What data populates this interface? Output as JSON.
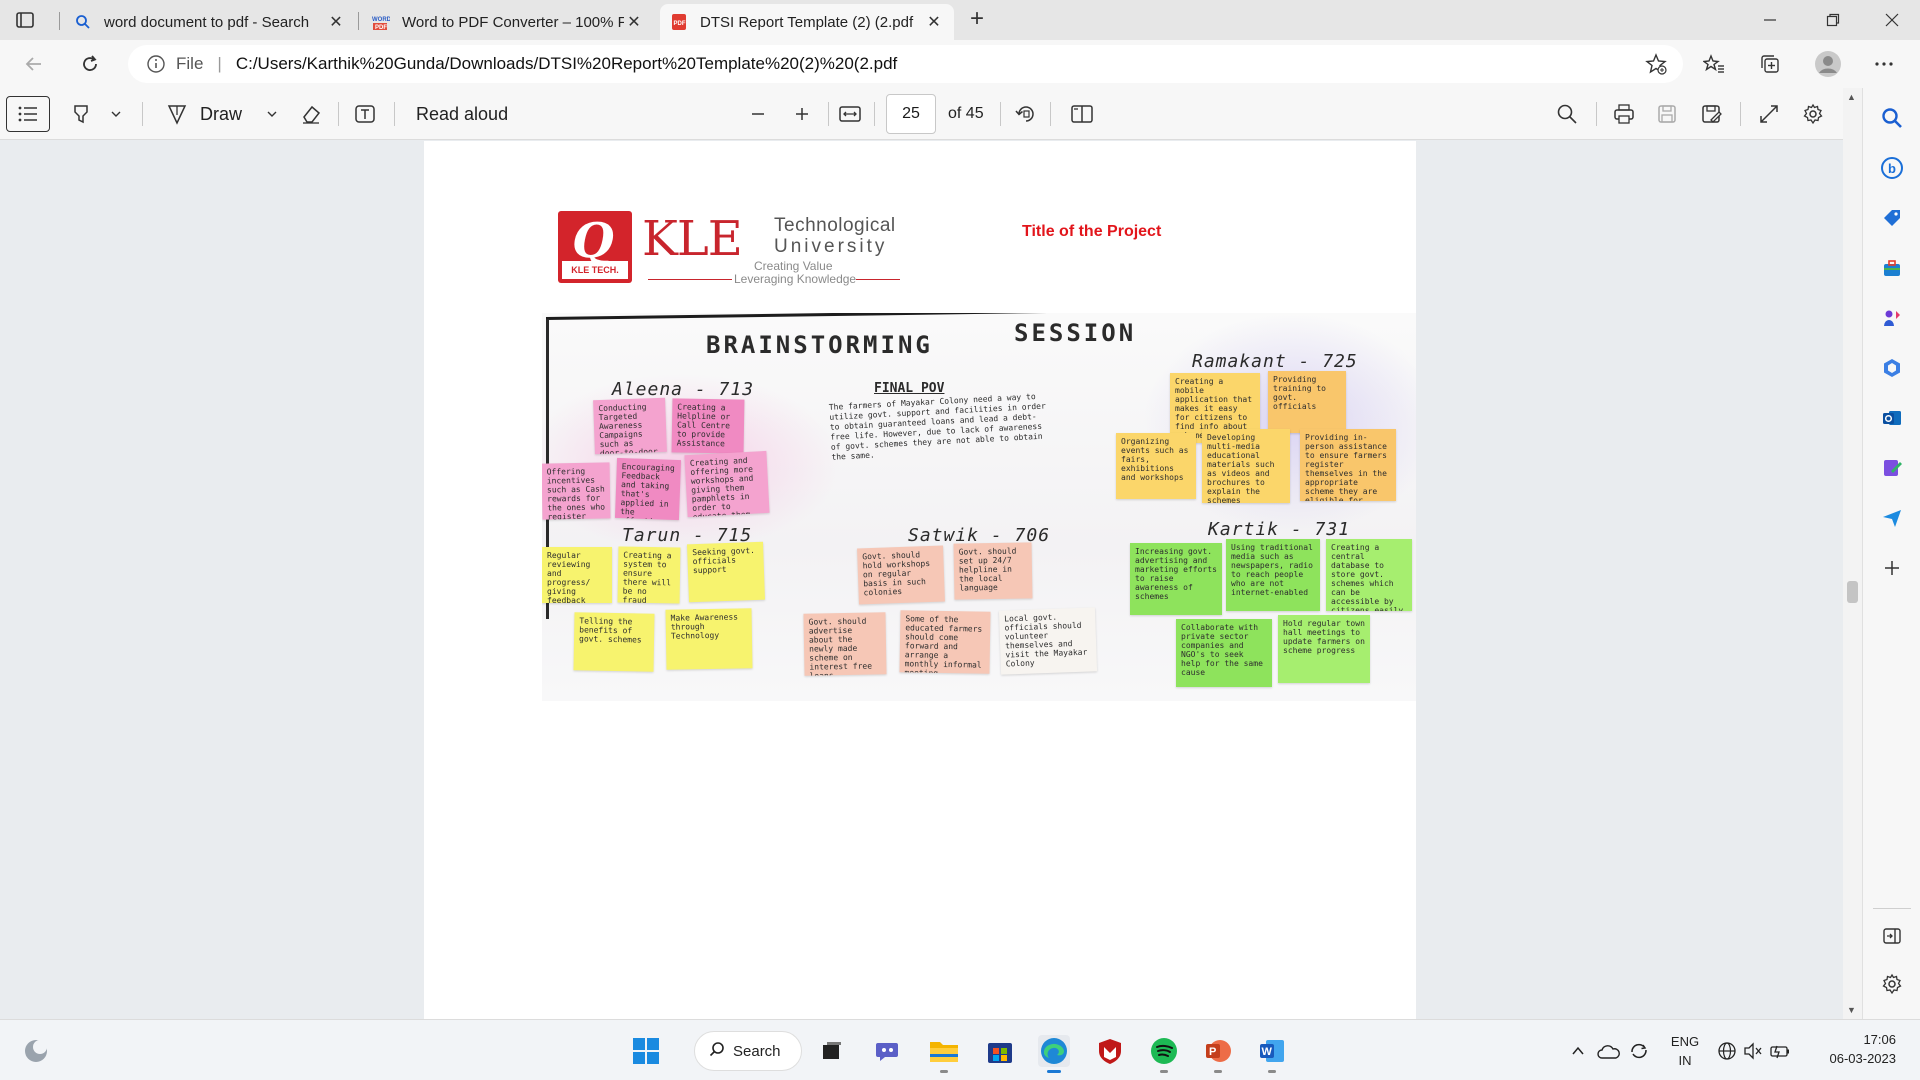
{
  "browser": {
    "tabs": [
      {
        "title": "word document to pdf - Search",
        "favicon": "search-icon",
        "active": false
      },
      {
        "title": "Word to PDF Converter – 100% F",
        "favicon": "word-pdf-icon",
        "active": false
      },
      {
        "title": "DTSI Report Template (2) (2.pdf",
        "favicon": "pdf-icon",
        "active": true
      }
    ],
    "address": {
      "scheme_label": "File",
      "url": "C:/Users/Karthik%20Gunda/Downloads/DTSI%20Report%20Template%20(2)%20(2.pdf"
    }
  },
  "pdf_toolbar": {
    "draw_label": "Draw",
    "read_aloud_label": "Read aloud",
    "current_page": "25",
    "page_count_label": "of 45"
  },
  "document": {
    "logo": {
      "kle": "KLE",
      "technological": "Technological",
      "university": "University",
      "tagline1": "Creating Value",
      "tagline2": "Leveraging Knowledge",
      "badge": "KLE TECH."
    },
    "project_title": "Title of the Project",
    "brainstorm": {
      "heading_left": "BRAINSTORMING",
      "heading_right": "SESSION",
      "final_pov_title": "FINAL POV",
      "final_pov_text": "The farmers of Mayakar Colony need a way to utilize govt. support and facilities in order to obtain guaranteed loans and lead a debt-free life. However, due to lack of awareness of govt. schemes they are not able to obtain the same.",
      "names": {
        "aleena": "Aleena - 713",
        "tarun": "Tarun - 715",
        "satwik": "Satwik - 706",
        "ramakant": "Ramakant - 725",
        "kartik": "Kartik - 731"
      },
      "notes": [
        "Conducting Targeted Awareness Campaigns such as door-to-door Campaigns",
        "Creating a Helpline or Call Centre to provide Assistance",
        "Offering incentives such as Cash rewards for the ones who register themselves for the scheme",
        "Encouraging Feedback and taking that's applied in the effectiveness of schemes",
        "Creating and offering more workshops and giving them pamphlets in order to educate them",
        "Regular reviewing and progress/ giving feedback",
        "Creating a system to ensure there will be no fraud",
        "Seeking govt. officials support",
        "Telling the benefits of govt. schemes",
        "Make Awareness through Technology",
        "Govt. should hold workshops on regular basis in such colonies",
        "Govt. should set up 24/7 helpline in the local language",
        "Govt. should advertise about the newly made scheme on interest free loans",
        "Some of the educated farmers should come forward and arrange a monthly informal meeting",
        "Local govt. officials should volunteer themselves and visit the Mayakar Colony",
        "Creating a mobile application that makes it easy for citizens to find info about schemes",
        "Providing training to govt. officials",
        "Organizing events such as fairs, exhibitions and workshops",
        "Developing multi-media educational materials such as videos and brochures to explain the schemes",
        "Providing in-person assistance to ensure farmers register themselves in the appropriate scheme they are eligible for",
        "Increasing govt. advertising and marketing efforts to raise awareness of schemes",
        "Using traditional media such as newspapers, radio to reach people who are not internet-enabled",
        "Creating a central database to store govt. schemes which can be accessible by citizens easily",
        "Collaborate with private sector companies and NGO's to seek help for the same cause",
        "Hold regular town hall meetings to update farmers on scheme progress"
      ]
    }
  },
  "taskbar": {
    "search_label": "Search",
    "language": "ENG",
    "region": "IN",
    "time": "17:06",
    "date": "06-03-2023"
  }
}
